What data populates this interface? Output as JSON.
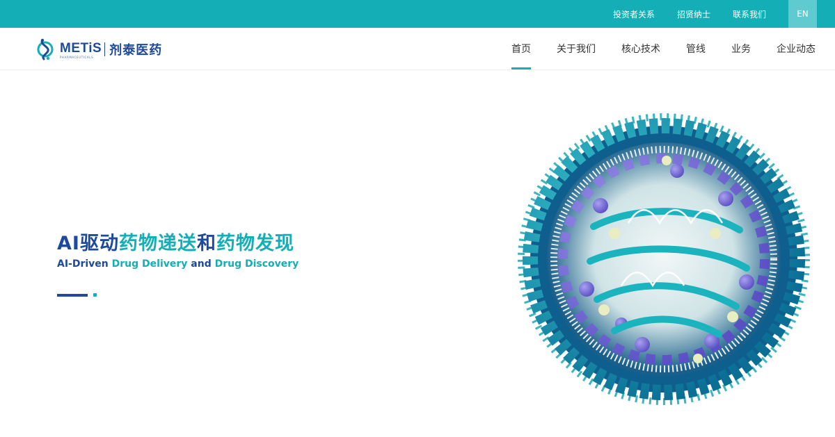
{
  "topbar": {
    "links": [
      "投资者关系",
      "招贤纳士",
      "联系我们"
    ],
    "lang_label": "EN"
  },
  "logo": {
    "name_en": "METiS",
    "sub_en": "PHARMACEUTICALS",
    "name_cn": "剂泰医药"
  },
  "nav": {
    "items": [
      "首页",
      "关于我们",
      "核心技术",
      "管线",
      "业务",
      "企业动态"
    ],
    "active_index": 0
  },
  "hero": {
    "title_parts": [
      "AI驱动",
      "药物递送",
      "和",
      "药物发现"
    ],
    "subtitle_parts": [
      "AI-Driven ",
      "Drug Delivery",
      " and ",
      "Drug Discovery"
    ]
  },
  "illustration": {
    "icon": "lipid-nanoparticle-image"
  },
  "colors": {
    "brand_teal": "#13aeb6",
    "brand_navy": "#1d4a9a",
    "lang_bg": "#5fcbd0"
  }
}
